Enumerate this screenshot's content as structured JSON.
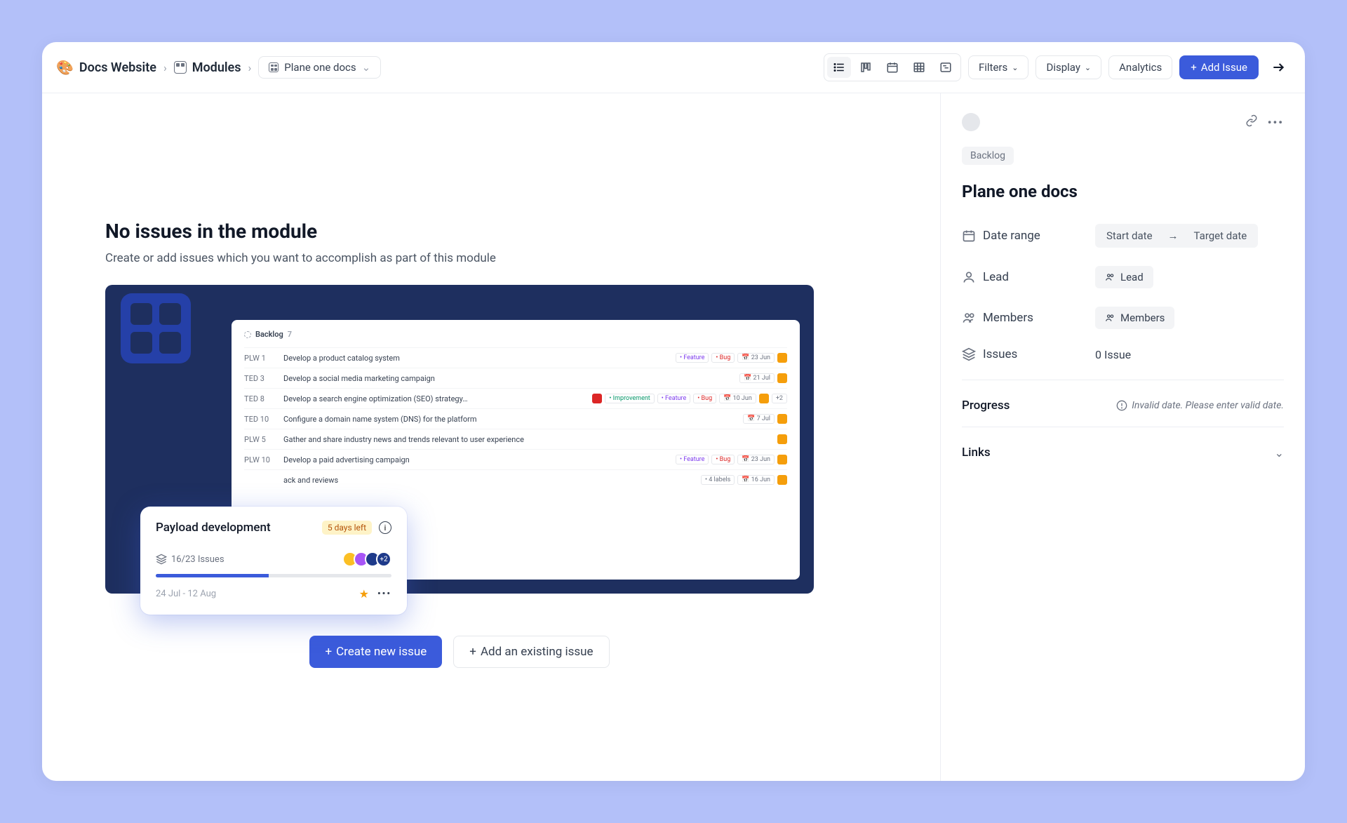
{
  "breadcrumb": {
    "project": "Docs Website",
    "section": "Modules",
    "module": "Plane one docs"
  },
  "toolbar": {
    "filters": "Filters",
    "display": "Display",
    "analytics": "Analytics",
    "add_issue": "Add Issue"
  },
  "empty_state": {
    "title": "No issues in the module",
    "subtitle": "Create or add issues which you want to accomplish as part of this module",
    "create_btn": "Create new issue",
    "add_existing_btn": "Add an existing issue"
  },
  "mock_backlog": {
    "header": "Backlog",
    "count": "7",
    "rows": [
      {
        "id": "PLW 1",
        "title": "Develop a product catalog system",
        "tags": [
          "Feature",
          "Bug"
        ],
        "date": "23 Jun"
      },
      {
        "id": "TED 3",
        "title": "Develop a social media marketing campaign",
        "tags": [],
        "date": "21 Jul"
      },
      {
        "id": "TED 8",
        "title": "Develop a search engine optimization (SEO) strategy…",
        "tags": [
          "Improvement",
          "Feature",
          "Bug"
        ],
        "date": "10 Jun",
        "red": true,
        "plus": "+2"
      },
      {
        "id": "TED 10",
        "title": "Configure a domain name system (DNS) for the platform",
        "tags": [],
        "date": "7 Jul"
      },
      {
        "id": "PLW 5",
        "title": "Gather and share industry news and trends relevant to user experience",
        "tags": [],
        "date": ""
      },
      {
        "id": "PLW 10",
        "title": "Develop a paid advertising campaign",
        "tags": [
          "Feature",
          "Bug"
        ],
        "date": "23 Jun"
      },
      {
        "id": "",
        "title": "ack and reviews",
        "tags": [
          "4 labels"
        ],
        "date": "16 Jun"
      }
    ]
  },
  "float_card": {
    "title": "Payload development",
    "days_left": "5 days left",
    "issues": "16/23 Issues",
    "dates": "24 Jul - 12 Aug",
    "plus": "+2"
  },
  "sidebar": {
    "state": "Backlog",
    "title": "Plane one docs",
    "fields": {
      "date_range": "Date range",
      "start_date": "Start date",
      "target_date": "Target date",
      "lead_label": "Lead",
      "lead_value": "Lead",
      "members_label": "Members",
      "members_value": "Members",
      "issues_label": "Issues",
      "issues_value": "0 Issue"
    },
    "progress": {
      "label": "Progress",
      "message": "Invalid date. Please enter valid date."
    },
    "links": {
      "label": "Links"
    }
  }
}
